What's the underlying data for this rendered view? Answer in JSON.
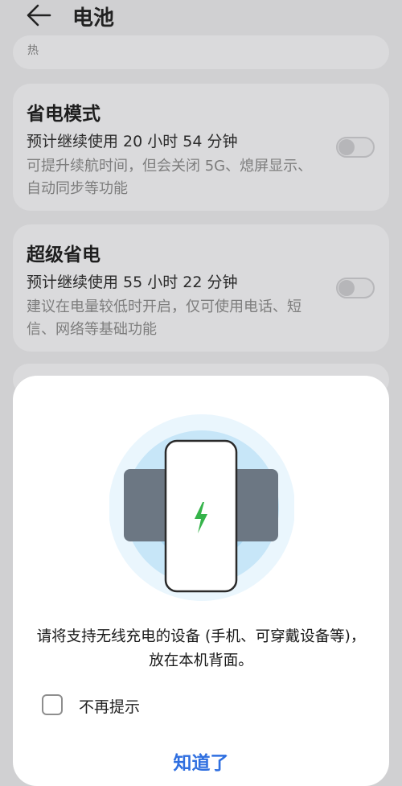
{
  "header": {
    "title": "电池",
    "back_icon": "back-arrow-icon"
  },
  "top_card": {
    "partial_text": "热"
  },
  "power_saving": {
    "title": "省电模式",
    "estimate": "预计继续使用 20 小时 54 分钟",
    "description": "可提升续航时间，但会关闭 5G、熄屏显示、自动同步等功能",
    "enabled": false
  },
  "super_saving": {
    "title": "超级省电",
    "estimate": "预计继续使用 55 小时 22 分钟",
    "description": "建议在电量较低时开启，仅可使用电话、短信、网络等基础功能",
    "enabled": false
  },
  "dialog": {
    "illustration": "wireless-charging-phone-illustration",
    "charging_icon": "lightning-bolt-icon",
    "message": "请将支持无线充电的设备 (手机、可穿戴设备等)，放在本机背面。",
    "checkbox_label": "不再提示",
    "checkbox_checked": false,
    "confirm_label": "知道了"
  },
  "colors": {
    "accent": "#2f6fe0",
    "bolt": "#35b34a",
    "background": "#d0d0d2",
    "card": "#dadadc",
    "ring": "#c7e6f8"
  }
}
